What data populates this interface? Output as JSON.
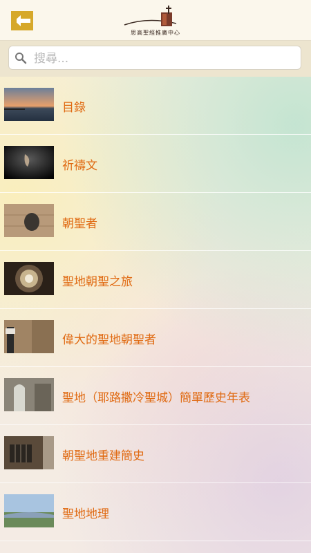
{
  "header": {
    "back_icon": "back-arrow-icon",
    "logo_text": "思高聖經推廣中心",
    "accent_color": "#d6a82a"
  },
  "search": {
    "placeholder": "搜尋...",
    "value": ""
  },
  "list": {
    "label_color": "#e06a12",
    "items": [
      {
        "label": "目錄"
      },
      {
        "label": "祈禱文"
      },
      {
        "label": "朝聖者"
      },
      {
        "label": "聖地朝聖之旅"
      },
      {
        "label": "偉大的聖地朝聖者"
      },
      {
        "label": "聖地（耶路撒冷聖城）簡單歷史年表"
      },
      {
        "label": "朝聖地重建簡史"
      },
      {
        "label": "聖地地理"
      }
    ]
  }
}
